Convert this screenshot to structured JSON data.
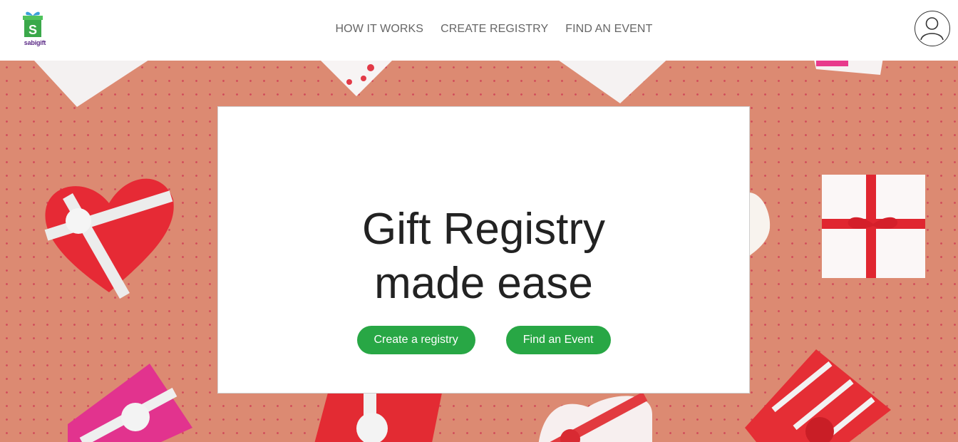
{
  "brand": {
    "logo_text_part1": "sabi",
    "logo_text_part2": "gift",
    "logo_letter": "S"
  },
  "nav": {
    "items": [
      {
        "label": "HOW IT WORKS"
      },
      {
        "label": "CREATE REGISTRY"
      },
      {
        "label": "FIND AN EVENT"
      }
    ]
  },
  "account": {
    "icon": "user-avatar-icon"
  },
  "hero": {
    "headline_line1": "Gift Registry",
    "headline_line2": "made ease",
    "primary_button": "Create a registry",
    "secondary_button": "Find an Event"
  },
  "colors": {
    "hero_background": "#dc8a72",
    "button_green": "#28a745",
    "nav_text": "#666666",
    "headline_text": "#222222"
  }
}
